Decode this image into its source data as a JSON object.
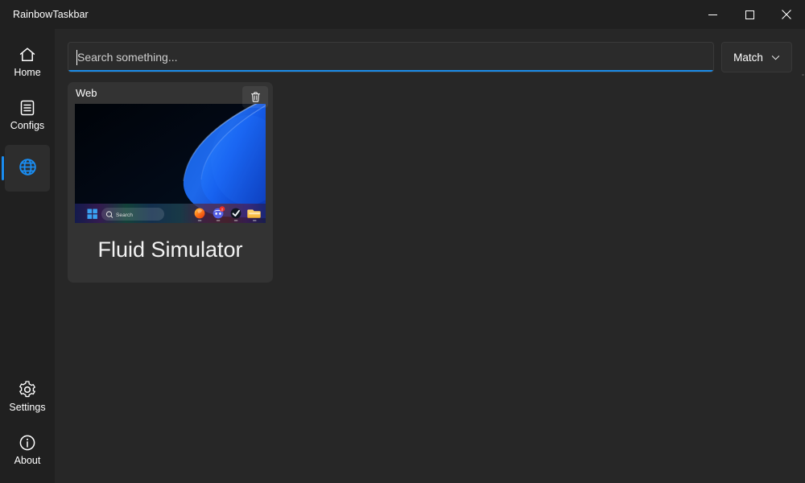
{
  "window": {
    "title": "RainbowTaskbar",
    "controls": [
      {
        "name": "minimize",
        "label": "Minimize"
      },
      {
        "name": "maximize",
        "label": "Maximize"
      },
      {
        "name": "close",
        "label": "Close"
      }
    ]
  },
  "sidebar": {
    "top_items": [
      {
        "label": "Home",
        "icon": "home-icon",
        "selected": false
      },
      {
        "label": "Configs",
        "icon": "list-icon",
        "selected": false
      },
      {
        "label": "",
        "icon": "globe-icon",
        "selected": true
      }
    ],
    "bottom_items": [
      {
        "label": "Settings",
        "icon": "gear-icon",
        "selected": false
      },
      {
        "label": "About",
        "icon": "info-icon",
        "selected": false
      }
    ]
  },
  "search": {
    "placeholder": "Search something...",
    "value": "",
    "focused": true,
    "accent_color": "#1a8ce9"
  },
  "match_dropdown": {
    "label": "Match",
    "icon": "chevron-down-icon"
  },
  "cards": [
    {
      "kind": "Web",
      "title": "Fluid Simulator",
      "delete_icon": "trash-icon",
      "thumbnail": {
        "description": "Windows 11 desktop with blue Bloom wallpaper and rainbow-glow taskbar",
        "taskbar_items": [
          "windows-start-icon",
          "search-pill",
          "firefox-icon",
          "discord-icon",
          "checkmark-icon",
          "file-explorer-icon"
        ],
        "search_pill_label": "Search"
      }
    }
  ],
  "colors": {
    "accent": "#1a8cf0",
    "sidebar_bg": "#202020",
    "content_bg": "#272727",
    "card_bg": "#333333"
  }
}
